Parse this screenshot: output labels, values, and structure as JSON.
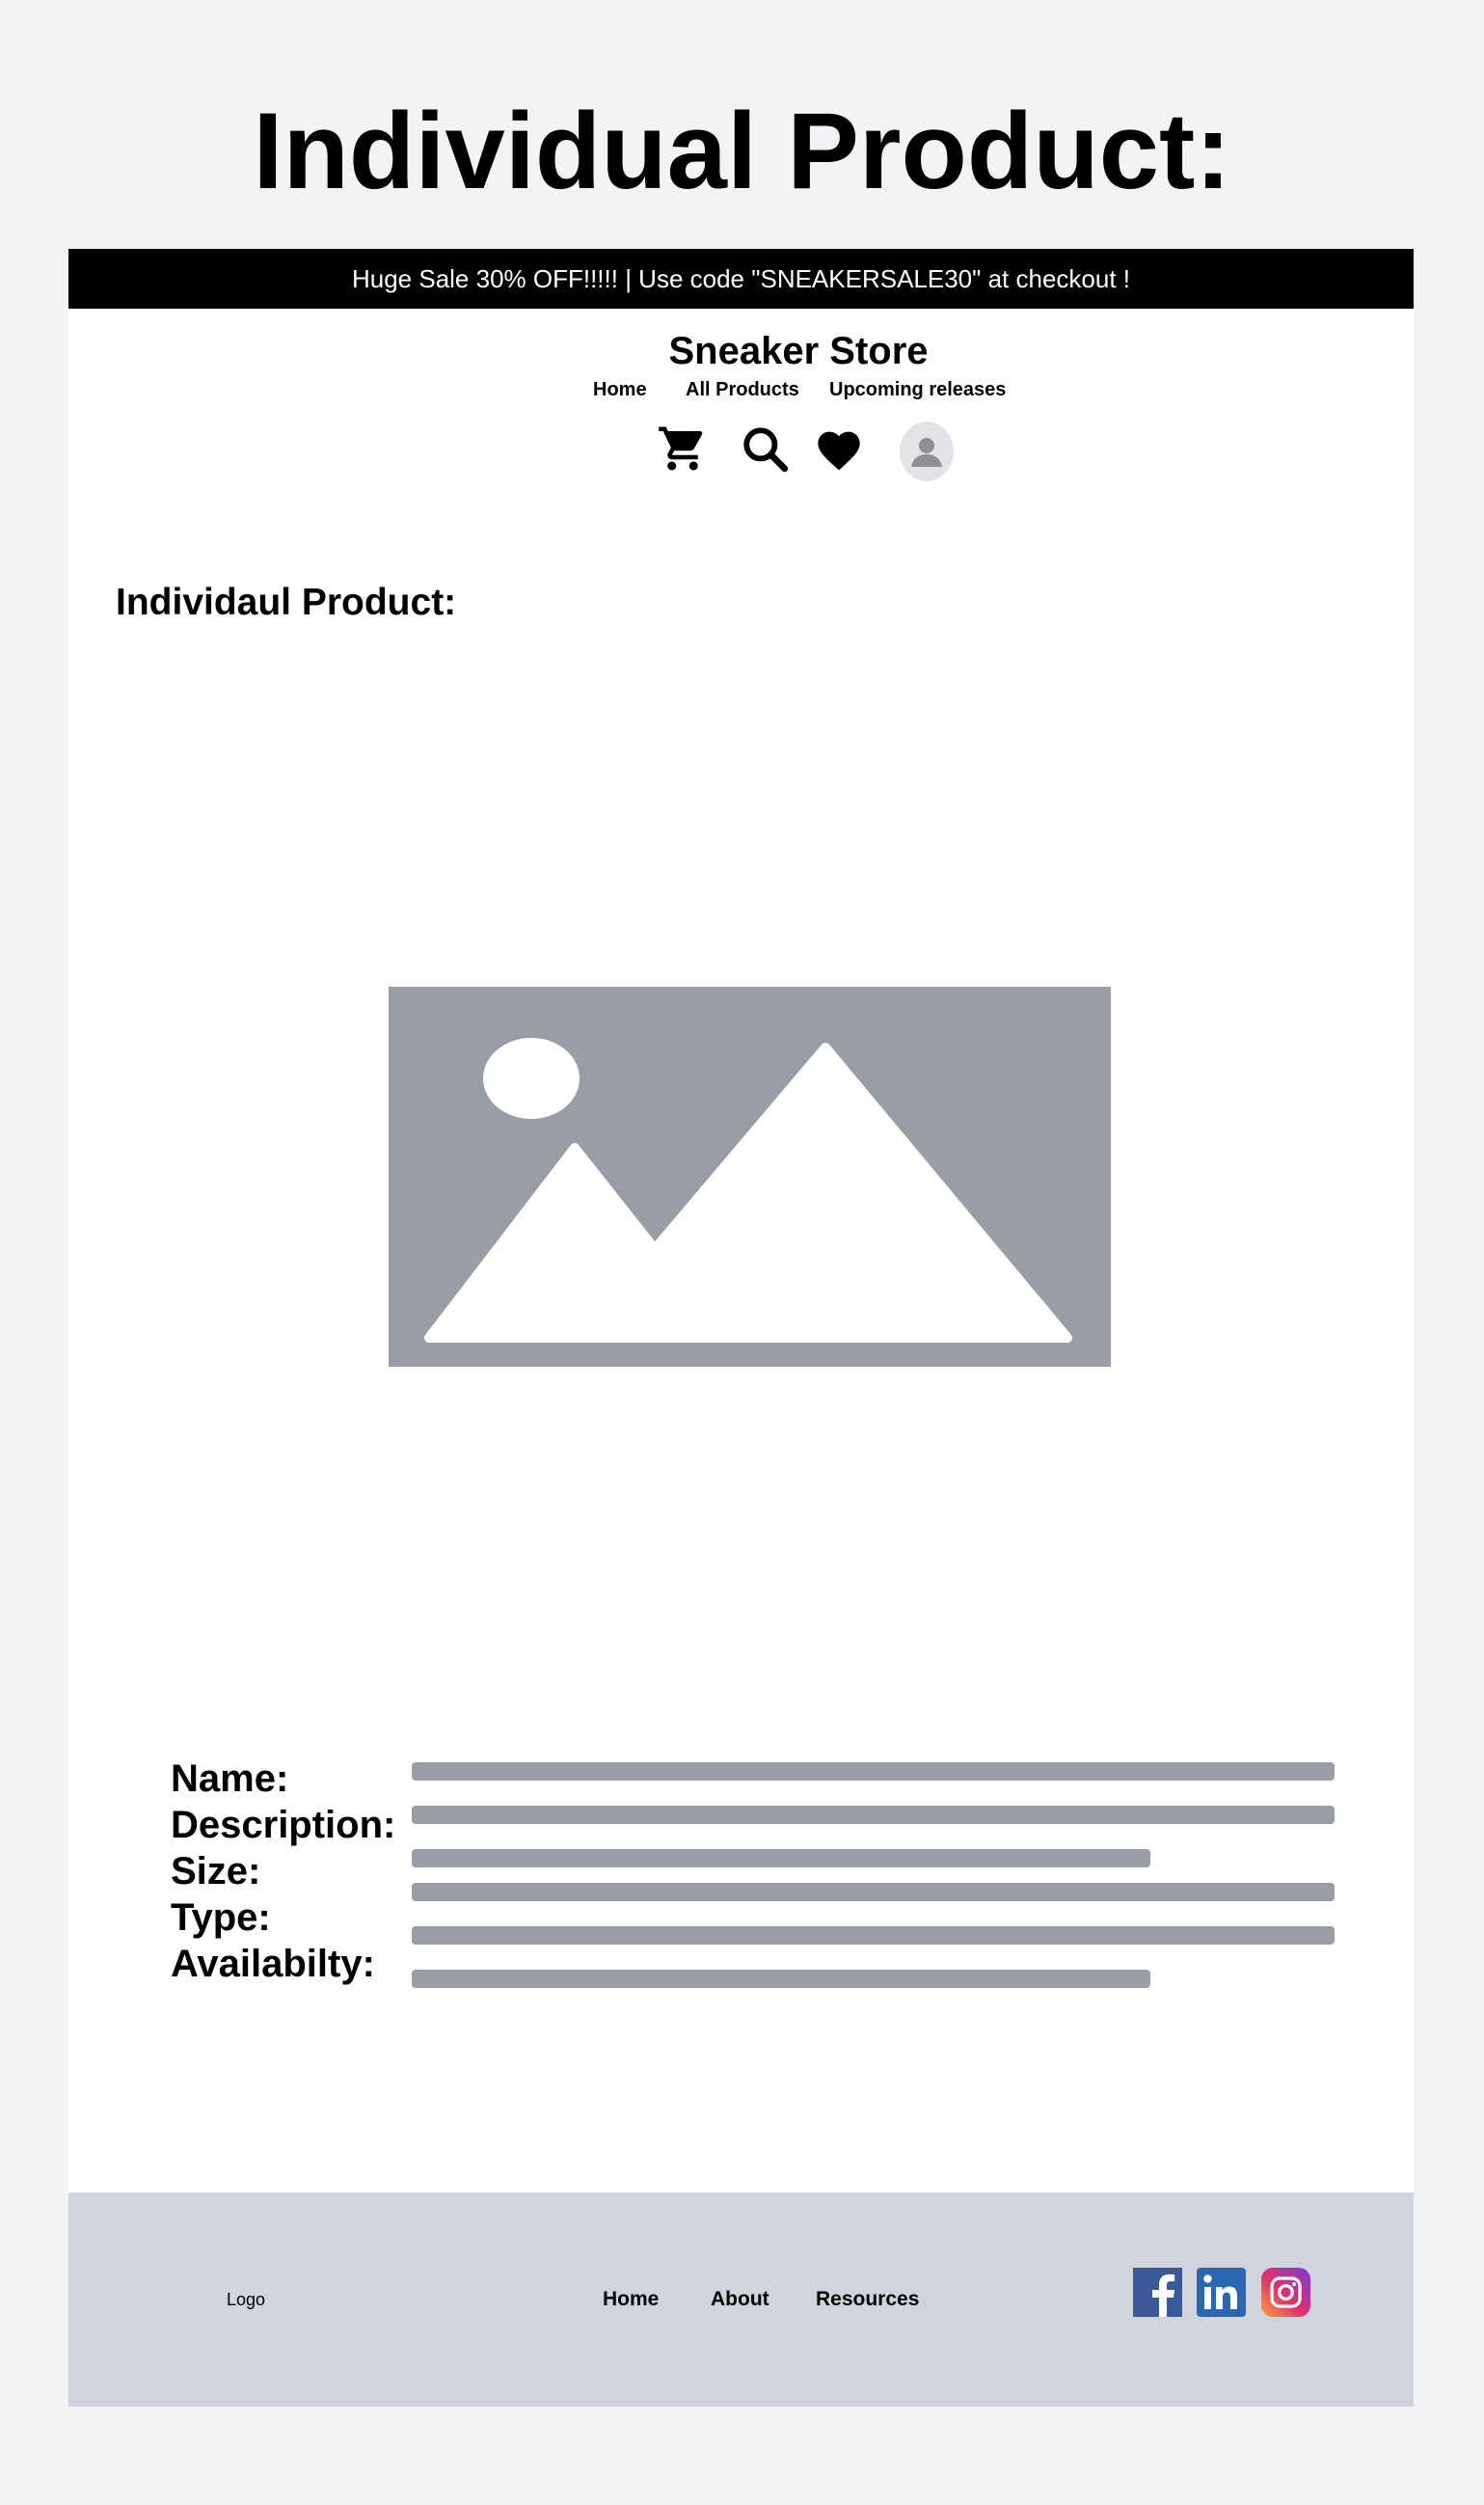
{
  "page": {
    "heading": "Individual Product:"
  },
  "promo": {
    "text": "Huge Sale 30% OFF!!!!! | Use code \"SNEAKERSALE30\" at checkout !"
  },
  "header": {
    "brand": "Sneaker Store",
    "nav": [
      "Home",
      "All Products",
      "Upcoming releases"
    ],
    "icons": [
      "cart-icon",
      "search-icon",
      "heart-icon",
      "user-avatar-icon"
    ]
  },
  "product": {
    "section_title": "Individaul Product:",
    "image_icon": "image-placeholder-icon",
    "fields": [
      "Name:",
      "Description:",
      "Size:",
      "Type:",
      "Availabilty:"
    ]
  },
  "footer": {
    "logo": "Logo",
    "links": [
      "Home",
      "About",
      "Resources"
    ],
    "social": [
      "facebook-icon",
      "linkedin-icon",
      "instagram-icon"
    ]
  },
  "colors": {
    "background": "#f2f3f5",
    "promo_bar": "#000000",
    "placeholder_gray": "#999ea6",
    "footer_bg": "#d0d4dc"
  }
}
